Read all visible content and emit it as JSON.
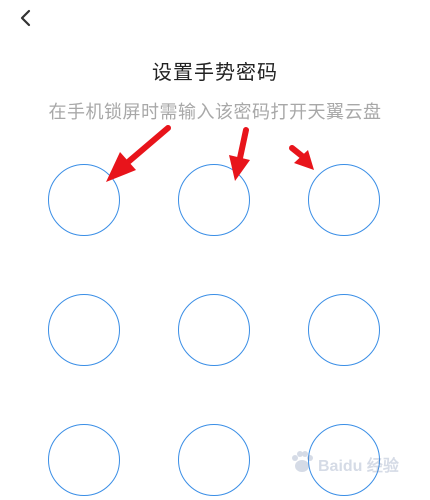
{
  "header": {
    "back_icon": "chevron-left-icon"
  },
  "title": "设置手势密码",
  "subtitle": "在手机锁屏时需输入该密码打开天翼云盘",
  "pattern": {
    "rows": 3,
    "cols": 3,
    "dot_color": "#3a8ee6",
    "dots": [
      {
        "id": 1
      },
      {
        "id": 2
      },
      {
        "id": 3
      },
      {
        "id": 4
      },
      {
        "id": 5
      },
      {
        "id": 6
      },
      {
        "id": 7
      },
      {
        "id": 8
      },
      {
        "id": 9
      }
    ]
  },
  "annotations": {
    "arrow_color": "#e8141b",
    "arrow_count": 3
  },
  "watermark": {
    "text": "Baidu 经验"
  }
}
